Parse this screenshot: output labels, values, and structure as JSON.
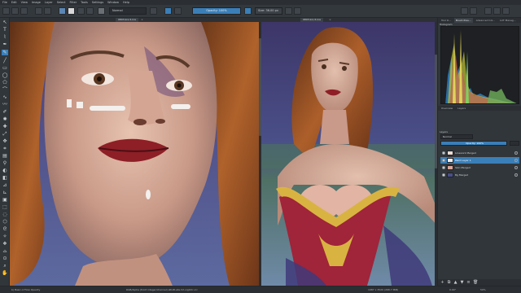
{
  "menu": [
    "File",
    "Edit",
    "View",
    "Image",
    "Layer",
    "Select",
    "Filter",
    "Tools",
    "Settings",
    "Window",
    "Help"
  ],
  "toolbar": {
    "blend_mode": "Normal",
    "opacity_label": "Opacity: 100%",
    "size_label": "Size: 36.00 px"
  },
  "views": {
    "left_tab": "0803.kra 6.kra",
    "right_tab": "0803.kra 6.kra"
  },
  "docker": {
    "top_tabs": [
      "Tool O...",
      "Brush Pres...",
      "Advanced Col...",
      "LUT Manag..."
    ],
    "histogram_title": "Histogram",
    "overview_tabs": [
      "Overview",
      "Layers"
    ],
    "layers_title": "Layers",
    "blend_select": "Normal",
    "opacity": "Opacity: 100%",
    "layers": [
      {
        "name": "Linework Merged",
        "active": false
      },
      {
        "name": "Paint Layer 1",
        "active": true
      },
      {
        "name": "Skin Merged",
        "active": false
      },
      {
        "name": "Bg Merged",
        "active": false
      }
    ]
  },
  "status": {
    "brush": "b) Basic-4 Flow Opacity",
    "color_info": "RGB/Alpha (8-bit integer/channel) sRGB-elle-V2-srgbtrc.icc",
    "size_info": "1987 x 3520 (268.7 MiB)",
    "zoom_left": "100%",
    "zoom_right": "50%",
    "angle": "0.00°"
  },
  "colors": {
    "accent": "#3a7fb8",
    "panel": "#31363b",
    "dark": "#2b2f33"
  }
}
